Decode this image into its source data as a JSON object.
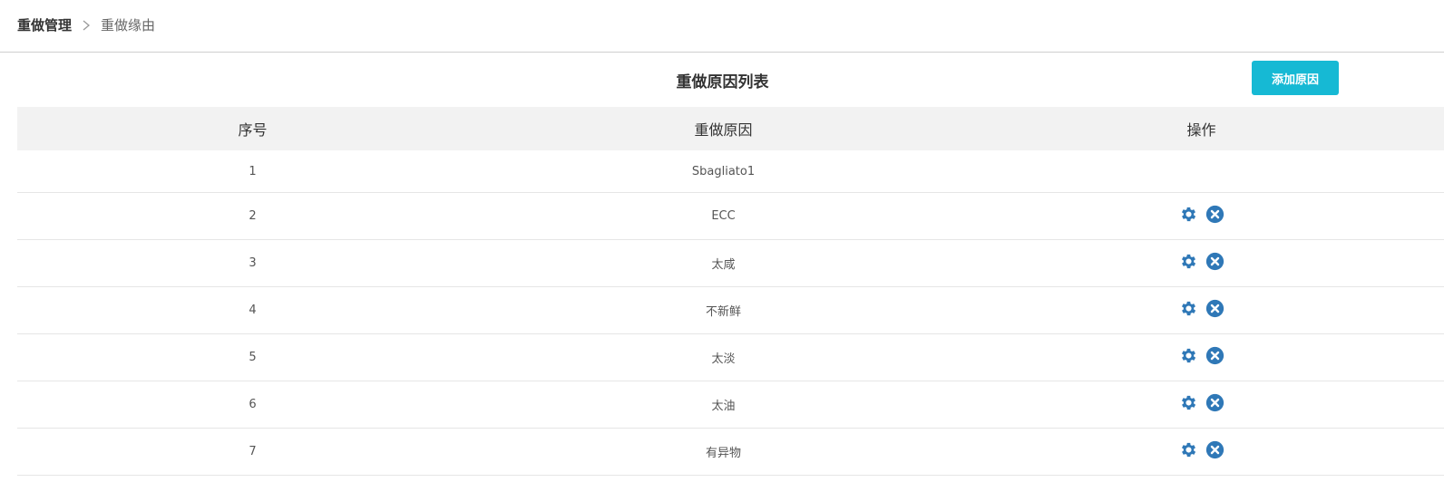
{
  "breadcrumb": {
    "root": "重做管理",
    "current": "重做缘由"
  },
  "panel": {
    "title": "重做原因列表",
    "add_button_label": "添加原因"
  },
  "table": {
    "headers": {
      "index": "序号",
      "reason": "重做原因",
      "operations": "操作"
    },
    "rows": [
      {
        "index": "1",
        "reason": "Sbagliato1",
        "actions": []
      },
      {
        "index": "2",
        "reason": "ECC",
        "actions": [
          "gear-icon",
          "close-circle-icon"
        ]
      },
      {
        "index": "3",
        "reason": "太咸",
        "actions": [
          "gear-icon",
          "close-circle-icon"
        ]
      },
      {
        "index": "4",
        "reason": "不新鲜",
        "actions": [
          "gear-icon",
          "close-circle-icon"
        ]
      },
      {
        "index": "5",
        "reason": "太淡",
        "actions": [
          "gear-icon",
          "close-circle-icon"
        ]
      },
      {
        "index": "6",
        "reason": "太油",
        "actions": [
          "gear-icon",
          "close-circle-icon"
        ]
      },
      {
        "index": "7",
        "reason": "有异物",
        "actions": [
          "gear-icon",
          "close-circle-icon"
        ]
      }
    ]
  },
  "colors": {
    "accent": "#16b9d4",
    "icon": "#2f78b7",
    "header_bg": "#f2f2f2"
  }
}
